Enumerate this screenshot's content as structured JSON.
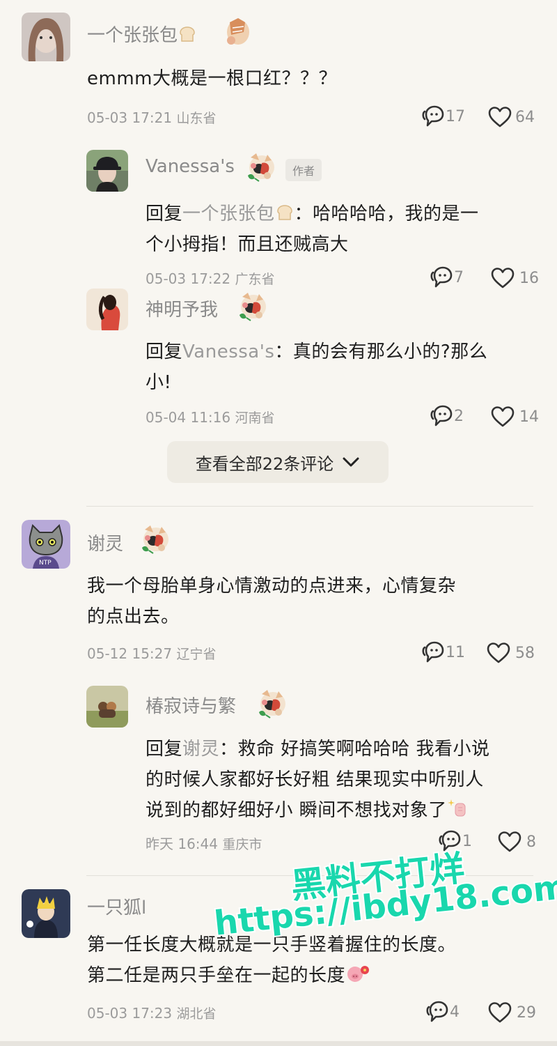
{
  "comments": [
    {
      "id": "c1",
      "user": "一个张张包",
      "text": "emmm大概是一根口红？？？",
      "date": "05-03 17:21",
      "location": "山东省",
      "replies": "17",
      "likes": "64"
    },
    {
      "id": "r1",
      "user": "Vanessa's",
      "author_tag": "作者",
      "reply_prefix": "回复",
      "reply_to": "一个张张包",
      "text_line1": "：哈哈哈哈，我的是一",
      "text_line2": "个小拇指！而且还贼高大",
      "date": "05-03 17:22",
      "location": "广东省",
      "replies": "7",
      "likes": "16"
    },
    {
      "id": "r2",
      "user": "神明予我",
      "reply_prefix": "回复",
      "reply_to": "Vanessa's",
      "text_line1": "：真的会有那么小的?那么",
      "text_line2": "小!",
      "date": "05-04 11:16",
      "location": "河南省",
      "replies": "2",
      "likes": "14"
    },
    {
      "id": "c2",
      "user": "谢灵",
      "text_line1": "我一个母胎单身心情激动的点进来，心情复杂",
      "text_line2": "的点出去。",
      "date": "05-12 15:27",
      "location": "辽宁省",
      "replies": "11",
      "likes": "58"
    },
    {
      "id": "r3",
      "user": "椿寂诗与繁",
      "reply_prefix": "回复",
      "reply_to": "谢灵",
      "text_line1": "：救命 好搞笑啊哈哈哈 我看小说",
      "text_line2": "的时候人家都好长好粗 结果现实中听别人",
      "text_line3": "说到的都好细好小 瞬间不想找对象了",
      "date": "昨天 16:44",
      "location": "重庆市",
      "replies": "1",
      "likes": "8"
    },
    {
      "id": "c3",
      "user": "一只狐l",
      "text_line1": "第一任长度大概就是一只手竖着握住的长度。",
      "text_line2": "第二任是两只手垒在一起的长度",
      "date": "05-03 17:23",
      "location": "湖北省",
      "replies": "4",
      "likes": "29"
    }
  ],
  "more_button": {
    "label": "查看全部22条评论"
  },
  "watermark": {
    "line1": "黑料不打烊",
    "line2": "https://ibdy18.com"
  },
  "icons": {
    "reply": "reply-bubble-icon",
    "like": "heart-icon",
    "badge": "character-badge-icon",
    "bread": "bread-emoji-icon",
    "chevron": "chevron-down-icon"
  },
  "colors": {
    "background": "#f8f6f1",
    "watermark": "#19d7ad",
    "meta": "#9b9b9b"
  }
}
